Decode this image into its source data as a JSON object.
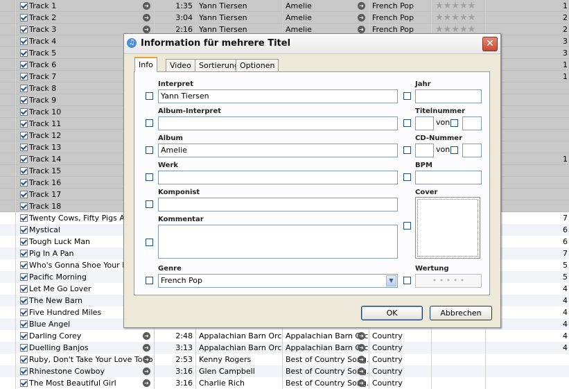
{
  "rows": [
    {
      "name": "Track 1",
      "time": "1:35",
      "artist": "Yann Tiersen",
      "album": "Amelie",
      "genre": "French Pop",
      "stars": "★★★★★",
      "n": "1",
      "sel": true
    },
    {
      "name": "Track 2",
      "time": "3:04",
      "artist": "Yann Tiersen",
      "album": "Amelie",
      "genre": "French Pop",
      "stars": "★★★★★",
      "n": "2",
      "sel": true
    },
    {
      "name": "Track 3",
      "time": "2:16",
      "artist": "Yann Tiersen",
      "album": "Amelie",
      "genre": "French Pop",
      "stars": "★★★★★",
      "n": "2",
      "sel": true
    },
    {
      "name": "Track 4",
      "time": "",
      "artist": "",
      "album": "",
      "genre": "",
      "stars": "",
      "n": "3",
      "sel": true
    },
    {
      "name": "Track 5",
      "time": "",
      "artist": "",
      "album": "",
      "genre": "",
      "stars": "",
      "n": "3",
      "sel": true
    },
    {
      "name": "Track 6",
      "time": "",
      "artist": "",
      "album": "",
      "genre": "",
      "stars": "",
      "n": "1",
      "sel": true
    },
    {
      "name": "Track 7",
      "time": "",
      "artist": "",
      "album": "",
      "genre": "",
      "stars": "",
      "n": "1",
      "sel": true
    },
    {
      "name": "Track 8",
      "time": "",
      "artist": "",
      "album": "",
      "genre": "",
      "stars": "",
      "n": "",
      "sel": true
    },
    {
      "name": "Track 9",
      "time": "",
      "artist": "",
      "album": "",
      "genre": "",
      "stars": "",
      "n": "",
      "sel": true
    },
    {
      "name": "Track 10",
      "time": "",
      "artist": "",
      "album": "",
      "genre": "",
      "stars": "",
      "n": "",
      "sel": true
    },
    {
      "name": "Track 11",
      "time": "",
      "artist": "",
      "album": "",
      "genre": "",
      "stars": "",
      "n": "",
      "sel": true
    },
    {
      "name": "Track 12",
      "time": "",
      "artist": "",
      "album": "",
      "genre": "",
      "stars": "",
      "n": "",
      "sel": true
    },
    {
      "name": "Track 13",
      "time": "",
      "artist": "",
      "album": "",
      "genre": "",
      "stars": "",
      "n": "",
      "sel": true
    },
    {
      "name": "Track 14",
      "time": "",
      "artist": "",
      "album": "",
      "genre": "",
      "stars": "",
      "n": "1",
      "sel": true
    },
    {
      "name": "Track 15",
      "time": "",
      "artist": "",
      "album": "",
      "genre": "",
      "stars": "",
      "n": "",
      "sel": true
    },
    {
      "name": "Track 16",
      "time": "",
      "artist": "",
      "album": "",
      "genre": "",
      "stars": "",
      "n": "",
      "sel": true
    },
    {
      "name": "Track 17",
      "time": "",
      "artist": "",
      "album": "",
      "genre": "",
      "stars": "",
      "n": "",
      "sel": true
    },
    {
      "name": "Track 18",
      "time": "",
      "artist": "",
      "album": "",
      "genre": "",
      "stars": "",
      "n": "",
      "sel": true
    },
    {
      "name": "Twenty Cows, Fifty Pigs And",
      "time": "",
      "artist": "",
      "album": "",
      "genre": "",
      "stars": "",
      "n": "7",
      "sel": false
    },
    {
      "name": "Mystical",
      "time": "",
      "artist": "",
      "album": "",
      "genre": "",
      "stars": "",
      "n": "6",
      "sel": false
    },
    {
      "name": "Tough Luck Man",
      "time": "",
      "artist": "",
      "album": "",
      "genre": "",
      "stars": "",
      "n": "6",
      "sel": false
    },
    {
      "name": "Pig In A Pan",
      "time": "",
      "artist": "",
      "album": "",
      "genre": "",
      "stars": "",
      "n": "7",
      "sel": false
    },
    {
      "name": "Who's Gonna Shoe Your Pretty",
      "time": "",
      "artist": "",
      "album": "",
      "genre": "",
      "stars": "",
      "n": "5",
      "sel": false
    },
    {
      "name": "Pacific Morning",
      "time": "",
      "artist": "",
      "album": "",
      "genre": "",
      "stars": "",
      "n": "5",
      "sel": false
    },
    {
      "name": "Let Me Go Lover",
      "time": "",
      "artist": "",
      "album": "",
      "genre": "",
      "stars": "",
      "n": "4",
      "sel": false
    },
    {
      "name": "The New Barn",
      "time": "",
      "artist": "",
      "album": "",
      "genre": "",
      "stars": "",
      "n": "4",
      "sel": false
    },
    {
      "name": "Five Hundred Miles",
      "time": "",
      "artist": "",
      "album": "",
      "genre": "",
      "stars": "",
      "n": "4",
      "sel": false
    },
    {
      "name": "Blue Angel",
      "time": "",
      "artist": "",
      "album": "",
      "genre": "",
      "stars": "",
      "n": "4",
      "sel": false
    },
    {
      "name": "Darling Corey",
      "time": "2:48",
      "artist": "Appalachian Barn Orc...",
      "album": "Appalachian Barn Orc...",
      "genre": "Country",
      "stars": "",
      "n": "4",
      "sel": false
    },
    {
      "name": "Duelling Banjos",
      "time": "3:13",
      "artist": "Appalachian Barn Orc...",
      "album": "Appalachian Barn Orc...",
      "genre": "Country",
      "stars": "",
      "n": "4",
      "sel": false
    },
    {
      "name": "Ruby, Don't Take Your Love To To...",
      "time": "2:53",
      "artist": "Kenny Rogers",
      "album": "Best of Country Song...",
      "genre": "Country",
      "stars": "",
      "n": "",
      "sel": false
    },
    {
      "name": "Rhinestone Cowboy",
      "time": "3:16",
      "artist": "Glen Campbell",
      "album": "Best of Country Song...",
      "genre": "Country",
      "stars": "",
      "n": "",
      "sel": false
    },
    {
      "name": "The Most Beautiful Girl",
      "time": "3:16",
      "artist": "Charlie Rich",
      "album": "Best of Country Song...",
      "genre": "Country",
      "stars": "",
      "n": "",
      "sel": false
    }
  ],
  "dialog": {
    "title": "Information für mehrere Titel",
    "close": "✕",
    "tabs": [
      "Info",
      "Video",
      "Sortierung",
      "Optionen"
    ],
    "labels": {
      "interpret": "Interpret",
      "album_interpret": "Album-Interpret",
      "album": "Album",
      "werk": "Werk",
      "komponist": "Komponist",
      "kommentar": "Kommentar",
      "genre": "Genre",
      "jahr": "Jahr",
      "titelnummer": "Titelnummer",
      "cd_nummer": "CD-Nummer",
      "bpm": "BPM",
      "cover": "Cover",
      "wertung": "Wertung",
      "von1": "von",
      "von2": "von"
    },
    "values": {
      "interpret": "Yann Tiersen",
      "album_interpret": "",
      "album": "Amelie",
      "werk": "",
      "komponist": "",
      "kommentar": "",
      "genre": "French Pop",
      "jahr": "",
      "titelnummer": "",
      "titel_von": "",
      "cd_nummer": "",
      "cd_von": "",
      "bpm": ""
    },
    "rating_dots": "• • • • •",
    "ok": "OK",
    "cancel": "Abbrechen"
  }
}
